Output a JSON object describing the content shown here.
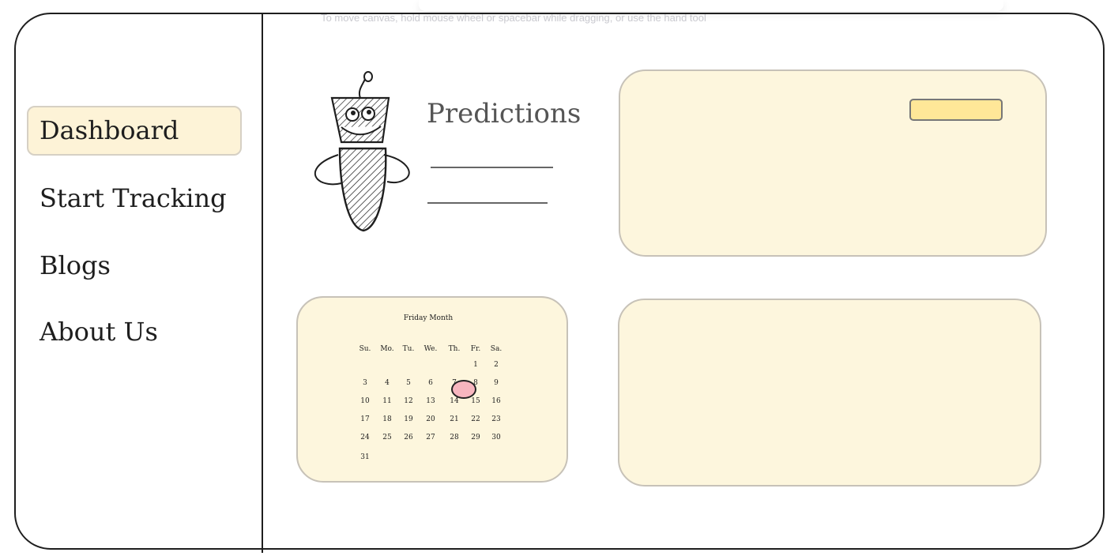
{
  "canvas_hint": "To move canvas, hold mouse wheel or spacebar while dragging, or use the hand tool",
  "sidebar": {
    "items": [
      {
        "label": "Dashboard",
        "active": true
      },
      {
        "label": "Start Tracking"
      },
      {
        "label": "Blogs"
      },
      {
        "label": "About Us"
      }
    ]
  },
  "predictions": {
    "title": "Predictions",
    "icon": "robot-icon"
  },
  "calendar": {
    "title": "Friday Month",
    "weekdays": [
      "Su.",
      "Mo.",
      "Tu.",
      "We.",
      "Th.",
      "Fr.",
      "Sa."
    ],
    "weeks": [
      [
        "",
        "",
        "",
        "",
        "",
        "1",
        "2"
      ],
      [
        "3",
        "4",
        "5",
        "6",
        "7",
        "8",
        "9"
      ],
      [
        "10",
        "11",
        "12",
        "13",
        "14",
        "15",
        "16"
      ],
      [
        "17",
        "18",
        "19",
        "20",
        "21",
        "22",
        "23"
      ],
      [
        "24",
        "25",
        "26",
        "27",
        "28",
        "29",
        "30"
      ],
      [
        "31",
        "",
        "",
        "",
        "",
        "",
        ""
      ]
    ],
    "highlighted_day": "7"
  },
  "colors": {
    "card_fill": "#fdf6dd",
    "highlight": "#fdf3d7",
    "button": "#ffe798",
    "marker": "#f7b6bf"
  }
}
